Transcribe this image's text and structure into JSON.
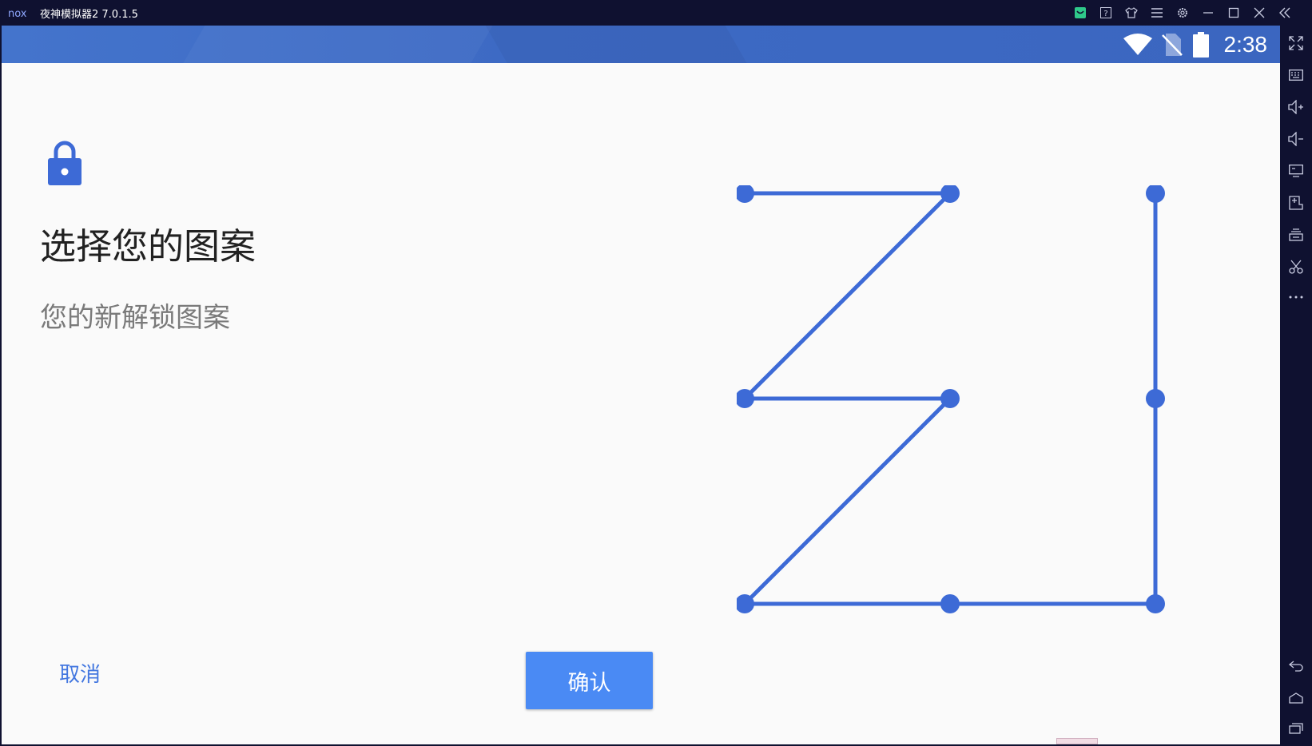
{
  "window": {
    "title": "夜神模拟器2 7.0.1.5",
    "logo_text": "nox"
  },
  "title_icons": [
    "app-store-icon",
    "help-icon",
    "skin-icon",
    "menu-icon",
    "settings-icon",
    "minimize-icon",
    "maximize-icon",
    "close-icon",
    "collapse-sidebar-icon"
  ],
  "status_bar": {
    "time": "2:38",
    "icons": [
      "wifi-icon",
      "no-sim-icon",
      "battery-icon"
    ]
  },
  "content": {
    "title": "选择您的图案",
    "subtitle": "您的新解锁图案"
  },
  "pattern": {
    "grid": "3x3",
    "color": "#3d6ad6",
    "sequence": [
      [
        0,
        0
      ],
      [
        1,
        0
      ],
      [
        0,
        1
      ],
      [
        1,
        1
      ],
      [
        0,
        2
      ],
      [
        1,
        2
      ],
      [
        2,
        2
      ],
      [
        2,
        1
      ],
      [
        2,
        0
      ]
    ]
  },
  "buttons": {
    "cancel": "取消",
    "confirm": "确认"
  },
  "sidebar_tools": [
    "fullscreen-icon",
    "keyboard-icon",
    "volume-up-icon",
    "volume-down-icon",
    "screen-icon",
    "apk-install-icon",
    "multi-instance-icon",
    "scissors-icon",
    "more-icon",
    "back-icon",
    "home-icon",
    "recent-apps-icon"
  ],
  "colors": {
    "accent": "#4a8af4",
    "status_bar": "#3d6ac4",
    "emulator_frame": "#0f1130"
  }
}
